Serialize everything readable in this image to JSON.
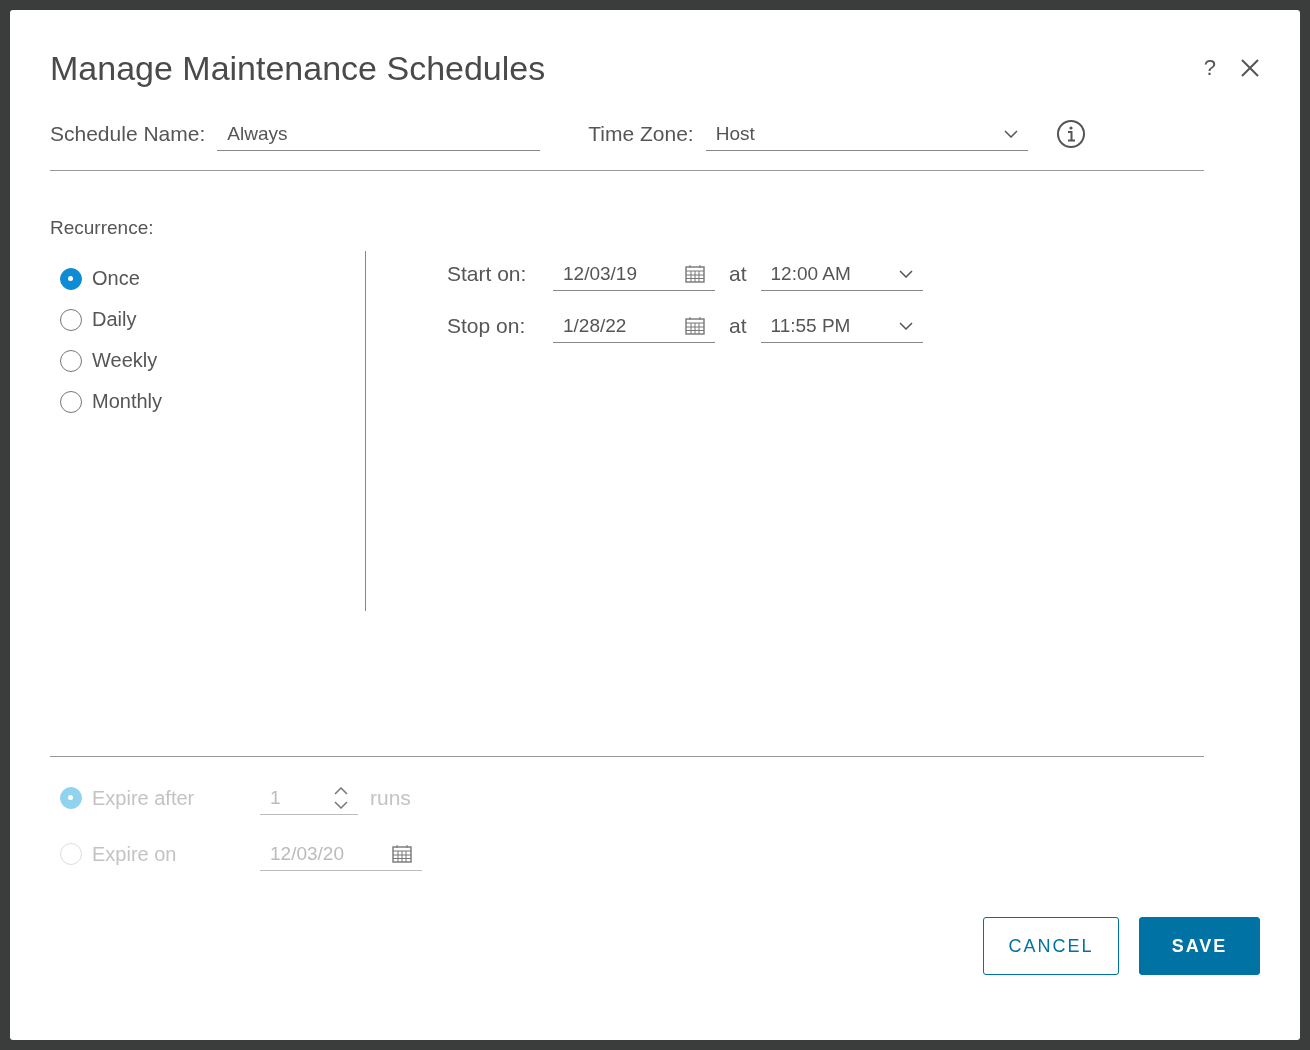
{
  "dialog": {
    "title": "Manage Maintenance Schedules",
    "help": "?"
  },
  "schedule_name": {
    "label": "Schedule Name:",
    "value": "Always"
  },
  "time_zone": {
    "label": "Time Zone:",
    "value": "Host"
  },
  "recurrence": {
    "label": "Recurrence:",
    "options": [
      {
        "label": "Once",
        "selected": true
      },
      {
        "label": "Daily",
        "selected": false
      },
      {
        "label": "Weekly",
        "selected": false
      },
      {
        "label": "Monthly",
        "selected": false
      }
    ]
  },
  "range": [
    {
      "label": "Start on:",
      "date": "12/03/19",
      "at": "at",
      "time": "12:00 AM"
    },
    {
      "label": "Stop on:",
      "date": "1/28/22",
      "at": "at",
      "time": "11:55 PM"
    }
  ],
  "expiry": {
    "disabled": true,
    "options": [
      {
        "kind": "count",
        "label": "Expire after",
        "selected": true,
        "value": "1",
        "unit": "runs"
      },
      {
        "kind": "date",
        "label": "Expire on",
        "selected": false,
        "value": "12/03/20"
      }
    ]
  },
  "buttons": [
    {
      "label": "CANCEL",
      "kind": "secondary"
    },
    {
      "label": "SAVE",
      "kind": "primary"
    }
  ]
}
